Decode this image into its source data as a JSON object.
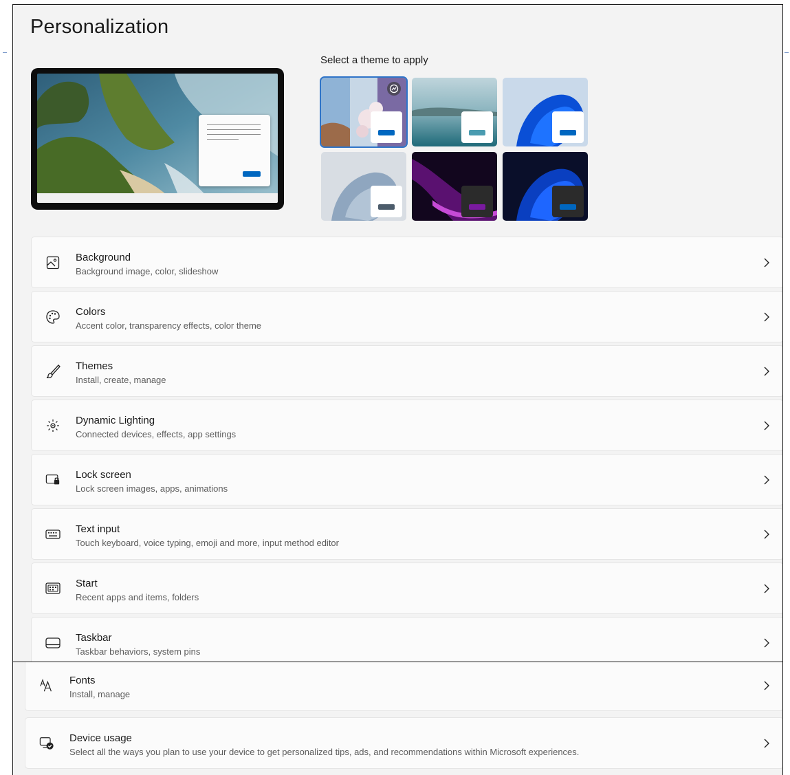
{
  "page": {
    "title": "Personalization"
  },
  "themes": {
    "label": "Select a theme to apply",
    "items": [
      {
        "name": "theme-1",
        "selected": true
      },
      {
        "name": "theme-2",
        "selected": false
      },
      {
        "name": "theme-3",
        "selected": false
      },
      {
        "name": "theme-4",
        "selected": false
      },
      {
        "name": "theme-5",
        "selected": false
      },
      {
        "name": "theme-6",
        "selected": false
      }
    ]
  },
  "settings": [
    {
      "icon": "image-icon",
      "title": "Background",
      "subtitle": "Background image, color, slideshow"
    },
    {
      "icon": "palette-icon",
      "title": "Colors",
      "subtitle": "Accent color, transparency effects, color theme"
    },
    {
      "icon": "brush-icon",
      "title": "Themes",
      "subtitle": "Install, create, manage"
    },
    {
      "icon": "dynamic-lighting-icon",
      "title": "Dynamic Lighting",
      "subtitle": "Connected devices, effects, app settings"
    },
    {
      "icon": "lock-screen-icon",
      "title": "Lock screen",
      "subtitle": "Lock screen images, apps, animations"
    },
    {
      "icon": "keyboard-icon",
      "title": "Text input",
      "subtitle": "Touch keyboard, voice typing, emoji and more, input method editor"
    },
    {
      "icon": "start-icon",
      "title": "Start",
      "subtitle": "Recent apps and items, folders"
    },
    {
      "icon": "taskbar-icon",
      "title": "Taskbar",
      "subtitle": "Taskbar behaviors, system pins"
    },
    {
      "icon": "fonts-icon",
      "title": "Fonts",
      "subtitle": "Install, manage"
    },
    {
      "icon": "device-usage-icon",
      "title": "Device usage",
      "subtitle": "Select all the ways you plan to use your device to get personalized tips, ads, and recommendations within Microsoft experiences."
    }
  ],
  "colors": {
    "accent": "#0067c0",
    "selection": "#2f74c8"
  }
}
